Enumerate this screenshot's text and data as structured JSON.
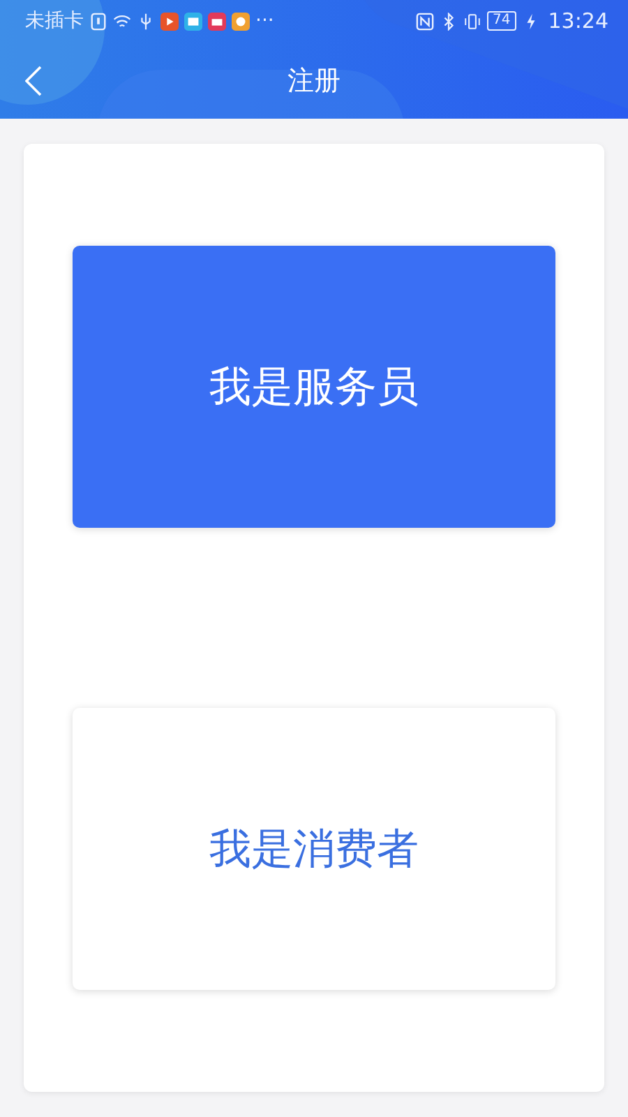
{
  "status_bar": {
    "carrier": "未插卡",
    "more": "···",
    "battery": "74",
    "time": "13:24"
  },
  "header": {
    "title": "注册"
  },
  "options": [
    {
      "label": "我是服务员",
      "selected": true
    },
    {
      "label": "我是消费者",
      "selected": false
    }
  ]
}
